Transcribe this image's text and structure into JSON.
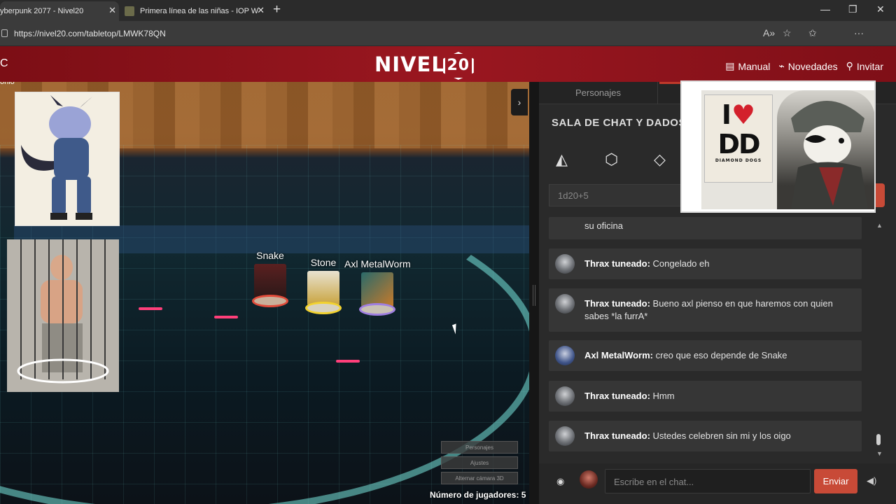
{
  "browser": {
    "tabs": [
      {
        "title": "yberpunk 2077 - Nivel20",
        "active": true
      },
      {
        "title": "Primera línea de las niñas - IOP W",
        "active": false
      }
    ],
    "close_symbol": "✕",
    "new_tab_symbol": "+",
    "window_buttons": [
      "—",
      "❐",
      "✕"
    ],
    "url": "https://nivel20.com/tabletop/LMWK78QN"
  },
  "site": {
    "logo_text": "NIVEL",
    "logo_number": "20",
    "nav_left": "C",
    "nav": {
      "manual": "Manual",
      "news": "Novedades",
      "invite": "Invitar"
    }
  },
  "tabletop": {
    "tokens": [
      {
        "name": "Snake",
        "ring_color": "#e04b3a"
      },
      {
        "name": "Stone",
        "ring_color": "#f2d230"
      },
      {
        "name": "Axl MetalWorm",
        "ring_color": "#a07fe0"
      }
    ],
    "side_label": "onio",
    "menu": [
      "Personajes",
      "Ajustes",
      "Alternar cámara 3D"
    ],
    "players_count": "Número de jugadores: 5",
    "toggle_symbol": "›"
  },
  "chat": {
    "tab_characters": "Personajes",
    "title": "SALA DE CHAT Y DADOS",
    "dice_placeholder": "1d20+5",
    "messages": [
      {
        "author": "",
        "text": "su oficina",
        "partial": true
      },
      {
        "author": "Thrax tuneado:",
        "text": " Congelado eh"
      },
      {
        "author": "Thrax tuneado:",
        "text": " Bueno axl pienso en que haremos con quien sabes *la furrA*"
      },
      {
        "author": "Axl MetalWorm:",
        "text": " creo que eso depende de Snake"
      },
      {
        "author": "Thrax tuneado:",
        "text": " Hmm"
      },
      {
        "author": "Thrax tuneado:",
        "text": " Ustedes celebren sin mi y los oigo"
      }
    ],
    "input_placeholder": "Escribe en el chat...",
    "send_label": "Enviar"
  },
  "webcam": {
    "sign_line1": "I",
    "sign_line2": "DD",
    "sign_caption": "DIAMOND DOGS"
  }
}
